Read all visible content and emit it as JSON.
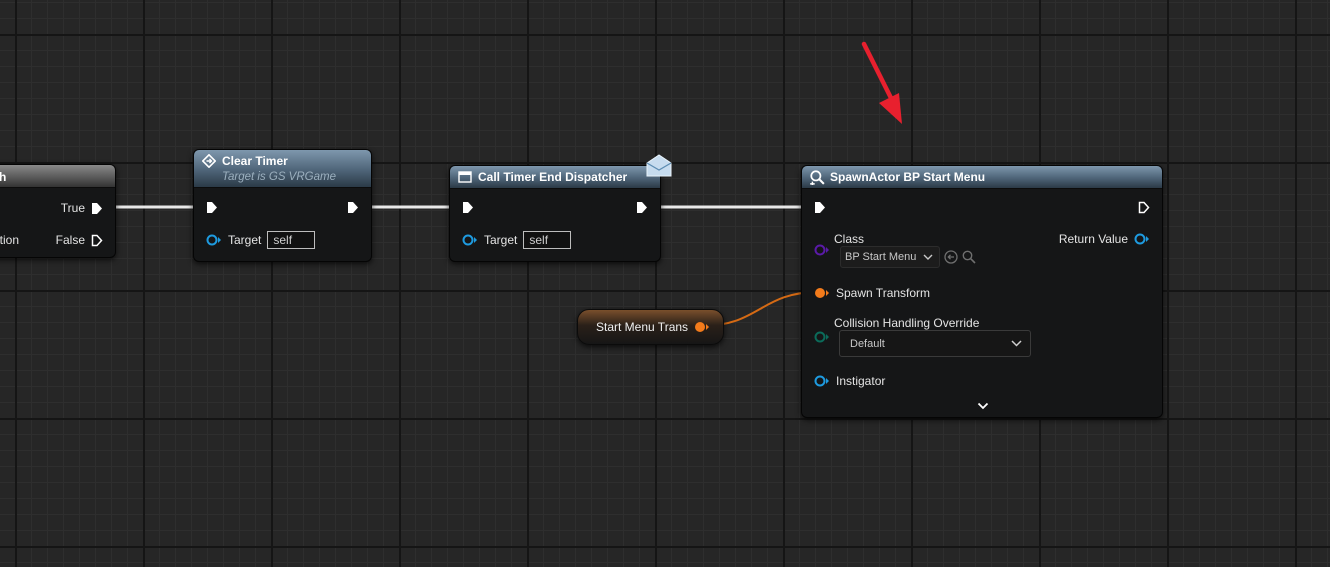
{
  "nodes": {
    "branch": {
      "title": "h",
      "true_label": "True",
      "false_label": "False",
      "condition_label": "ition"
    },
    "clear_timer": {
      "title": "Clear Timer",
      "subtitle": "Target is GS VRGame",
      "target_label": "Target",
      "target_value": "self"
    },
    "call_dispatcher": {
      "title": "Call Timer End Dispatcher",
      "target_label": "Target",
      "target_value": "self"
    },
    "spawn_actor": {
      "title": "SpawnActor BP Start Menu",
      "class_label": "Class",
      "class_value": "BP Start Menu",
      "return_label": "Return Value",
      "spawn_transform_label": "Spawn Transform",
      "collision_label": "Collision Handling Override",
      "collision_value": "Default",
      "instigator_label": "Instigator"
    },
    "variable": {
      "label": "Start Menu Trans"
    }
  },
  "colors": {
    "exec": "#ffffff",
    "object_pin": "#1e9be0",
    "class_pin": "#5a1aa8",
    "struct_pin": "#f37b1b",
    "enum_pin": "#0b6b5a",
    "annotation_arrow": "#e8202e"
  },
  "icons": {
    "clear_timer": "function-diamond-icon",
    "call_dispatcher": "dispatcher-window-icon",
    "dispatcher_badge": "envelope-icon",
    "spawn_actor": "spawn-actor-icon",
    "class_browse": "browse-arrow-icon",
    "class_search": "search-icon",
    "expand": "chevron-down-icon"
  }
}
